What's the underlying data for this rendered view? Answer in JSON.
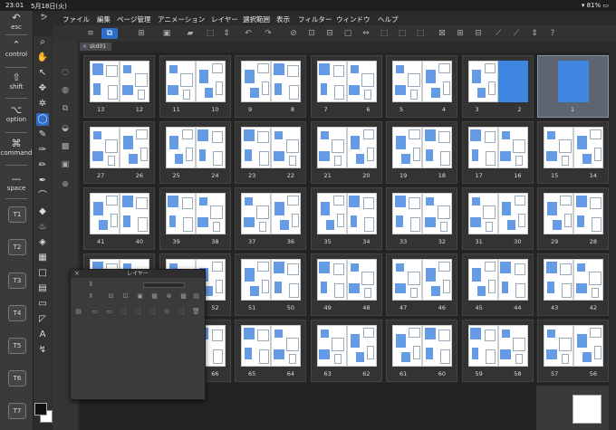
{
  "status": {
    "time": "23:01",
    "date": "5月18日(火)",
    "battery": "81%"
  },
  "menu": [
    "ファイル",
    "編集",
    "ページ管理",
    "アニメーション",
    "レイヤー",
    "選択範囲",
    "表示",
    "フィルター",
    "ウィンドウ",
    "ヘルプ"
  ],
  "modifiers": [
    {
      "glyph": "↶",
      "label": "esc"
    },
    {
      "glyph": "",
      "label": "control"
    },
    {
      "glyph": "⇧",
      "label": "shift"
    },
    {
      "glyph": "⌥",
      "label": "option"
    },
    {
      "glyph": "⌘",
      "label": "command"
    },
    {
      "glyph": "—",
      "label": "space"
    }
  ],
  "touch_buttons": [
    "T1",
    "T2",
    "T3",
    "T4",
    "T5",
    "T6",
    "T7"
  ],
  "tab": {
    "label": "skd01"
  },
  "layer_window": {
    "title": "レイヤー"
  },
  "pages": [
    {
      "l": "13",
      "r": "12"
    },
    {
      "l": "11",
      "r": "10"
    },
    {
      "l": "9",
      "r": "8"
    },
    {
      "l": "7",
      "r": "6"
    },
    {
      "l": "5",
      "r": "4"
    },
    {
      "l": "3",
      "r": "2"
    },
    {
      "single": "1"
    },
    {
      "l": "27",
      "r": "26"
    },
    {
      "l": "25",
      "r": "24"
    },
    {
      "l": "23",
      "r": "22"
    },
    {
      "l": "21",
      "r": "20"
    },
    {
      "l": "19",
      "r": "18"
    },
    {
      "l": "17",
      "r": "16"
    },
    {
      "l": "15",
      "r": "14"
    },
    {
      "l": "41",
      "r": "40"
    },
    {
      "l": "39",
      "r": "38"
    },
    {
      "l": "37",
      "r": "36"
    },
    {
      "l": "35",
      "r": "34"
    },
    {
      "l": "33",
      "r": "32"
    },
    {
      "l": "31",
      "r": "30"
    },
    {
      "l": "29",
      "r": "28"
    },
    {
      "l": "",
      "r": ""
    },
    {
      "l": "",
      "r": "52"
    },
    {
      "l": "51",
      "r": "50"
    },
    {
      "l": "49",
      "r": "48"
    },
    {
      "l": "47",
      "r": "46"
    },
    {
      "l": "45",
      "r": "44"
    },
    {
      "l": "43",
      "r": "42"
    },
    {
      "l": "",
      "r": ""
    },
    {
      "l": "",
      "r": "66"
    },
    {
      "l": "65",
      "r": "64"
    },
    {
      "l": "63",
      "r": "62"
    },
    {
      "l": "61",
      "r": "60"
    },
    {
      "l": "59",
      "r": "58"
    },
    {
      "l": "57",
      "r": "56"
    }
  ],
  "colors": {
    "accent": "#2d6cc8",
    "ink": "#3e86e0"
  }
}
